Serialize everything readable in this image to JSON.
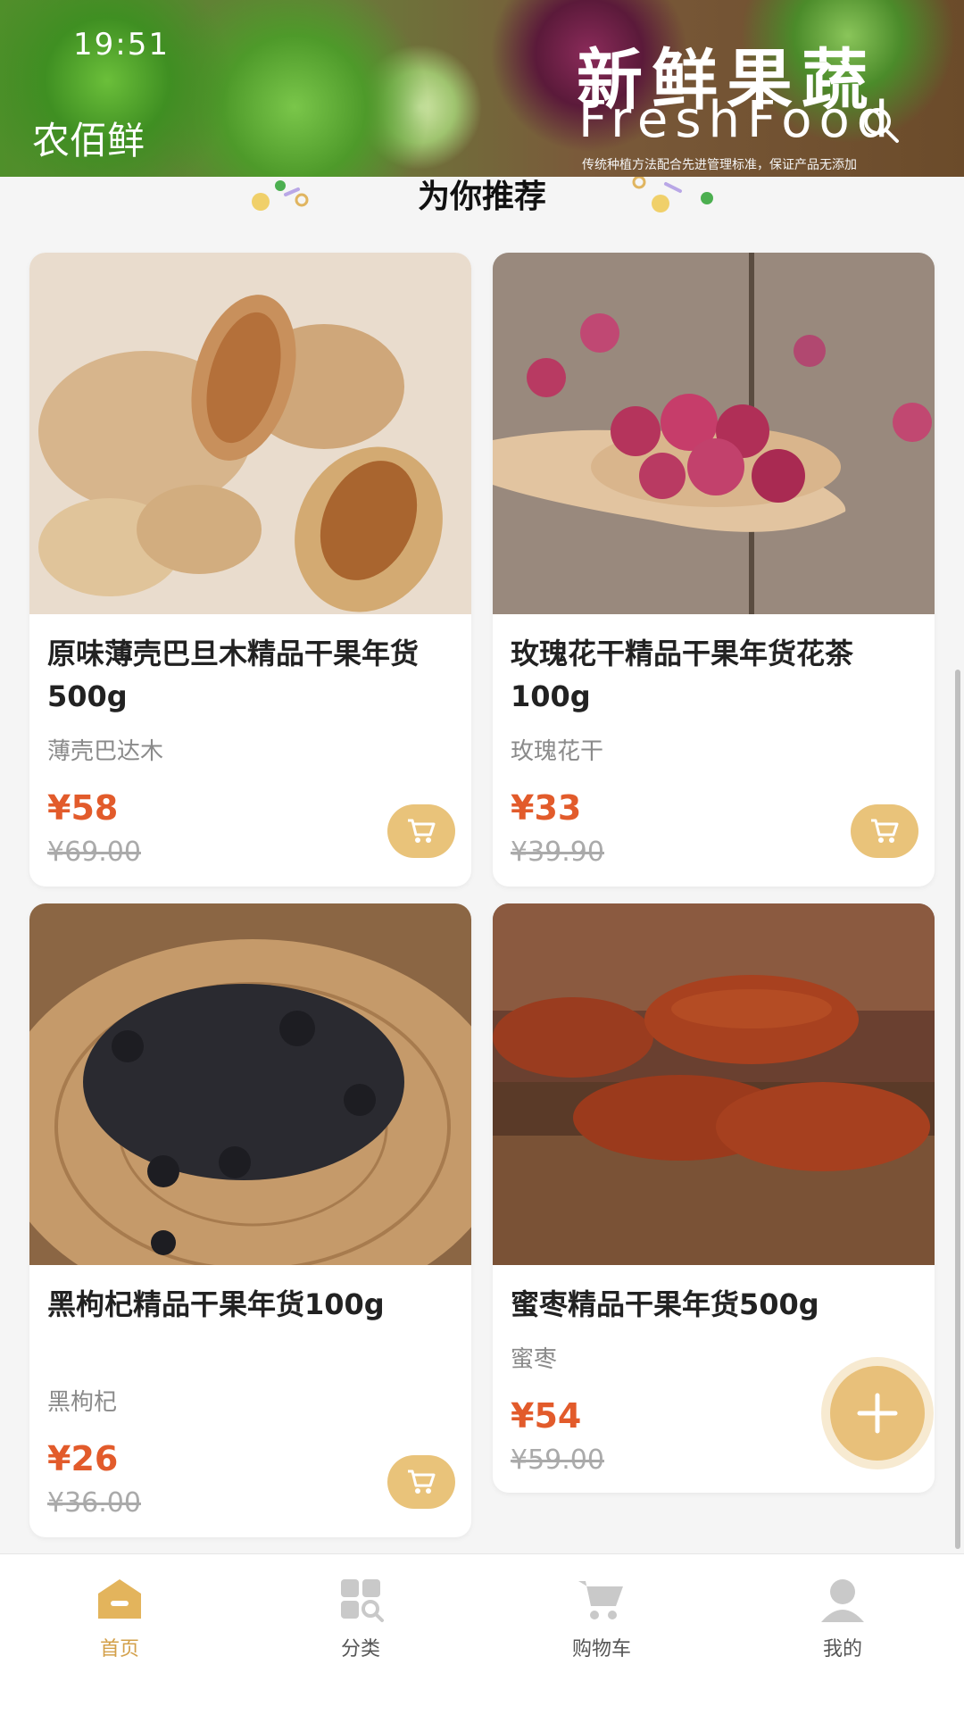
{
  "status_bar": {
    "time": "19:51"
  },
  "banner": {
    "brand": "农佰鲜",
    "title": "新鲜果蔬",
    "title_en": "FreshFood",
    "slogan": "传统种植方法配合先进管理标准，保证产品无添加"
  },
  "section": {
    "title": "为你推荐"
  },
  "products": [
    {
      "name": "原味薄壳巴旦木精品干果年货500g",
      "subtitle": "薄壳巴达木",
      "price": "¥58",
      "old_price": "¥69.00"
    },
    {
      "name": "玫瑰花干精品干果年货花茶100g",
      "subtitle": "玫瑰花干",
      "price": "¥33",
      "old_price": "¥39.90"
    },
    {
      "name": "黑枸杞精品干果年货100g",
      "subtitle": "黑枸杞",
      "price": "¥26",
      "old_price": "¥36.00"
    },
    {
      "name": "蜜枣精品干果年货500g",
      "subtitle": "蜜枣",
      "price": "¥54",
      "old_price": "¥59.00"
    }
  ],
  "tabbar": {
    "items": [
      {
        "label": "首页",
        "icon": "home-icon",
        "active": true
      },
      {
        "label": "分类",
        "icon": "category-icon",
        "active": false
      },
      {
        "label": "购物车",
        "icon": "cart-icon",
        "active": false
      },
      {
        "label": "我的",
        "icon": "user-icon",
        "active": false
      }
    ]
  },
  "colors": {
    "accent": "#e9c37a",
    "price": "#e25b2b",
    "active_tab": "#d3a04a"
  }
}
